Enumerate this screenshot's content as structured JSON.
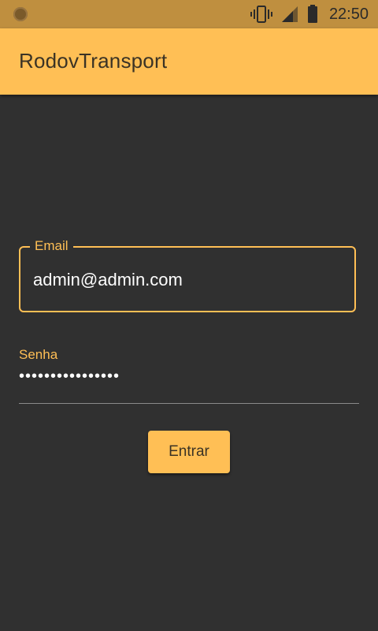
{
  "status_bar": {
    "time": "22:50",
    "icons": [
      "notification-dot-icon",
      "vibrate-icon",
      "signal-icon",
      "battery-icon"
    ]
  },
  "app_bar": {
    "title": "RodovTransport"
  },
  "login_form": {
    "email": {
      "label": "Email",
      "value": "admin@admin.com"
    },
    "password": {
      "label": "Senha",
      "value": "••••••••••••••••"
    },
    "submit_label": "Entrar"
  },
  "colors": {
    "accent": "#ffbf55",
    "background": "#303030",
    "status_bar": "#bf8f3f"
  }
}
